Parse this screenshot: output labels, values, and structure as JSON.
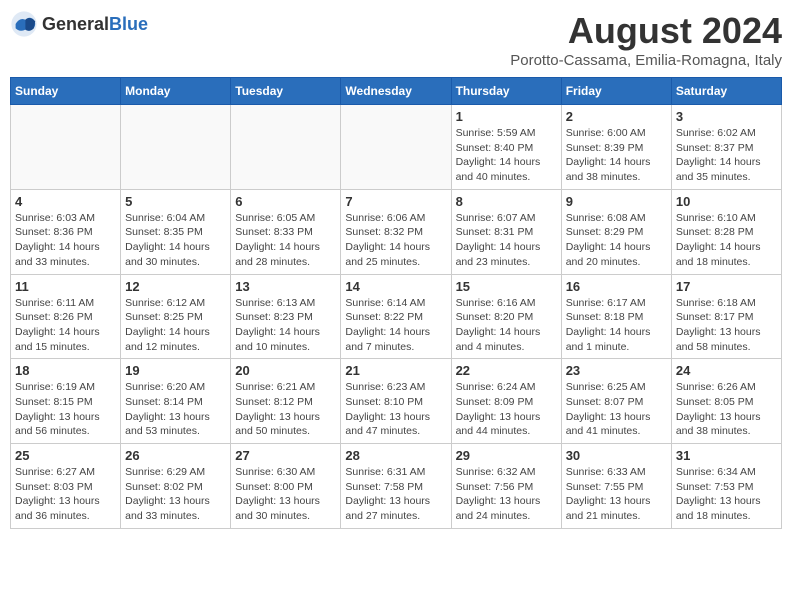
{
  "header": {
    "logo_general": "General",
    "logo_blue": "Blue",
    "main_title": "August 2024",
    "subtitle": "Porotto-Cassama, Emilia-Romagna, Italy"
  },
  "weekdays": [
    "Sunday",
    "Monday",
    "Tuesday",
    "Wednesday",
    "Thursday",
    "Friday",
    "Saturday"
  ],
  "weeks": [
    [
      {
        "day": "",
        "info": ""
      },
      {
        "day": "",
        "info": ""
      },
      {
        "day": "",
        "info": ""
      },
      {
        "day": "",
        "info": ""
      },
      {
        "day": "1",
        "info": "Sunrise: 5:59 AM\nSunset: 8:40 PM\nDaylight: 14 hours\nand 40 minutes."
      },
      {
        "day": "2",
        "info": "Sunrise: 6:00 AM\nSunset: 8:39 PM\nDaylight: 14 hours\nand 38 minutes."
      },
      {
        "day": "3",
        "info": "Sunrise: 6:02 AM\nSunset: 8:37 PM\nDaylight: 14 hours\nand 35 minutes."
      }
    ],
    [
      {
        "day": "4",
        "info": "Sunrise: 6:03 AM\nSunset: 8:36 PM\nDaylight: 14 hours\nand 33 minutes."
      },
      {
        "day": "5",
        "info": "Sunrise: 6:04 AM\nSunset: 8:35 PM\nDaylight: 14 hours\nand 30 minutes."
      },
      {
        "day": "6",
        "info": "Sunrise: 6:05 AM\nSunset: 8:33 PM\nDaylight: 14 hours\nand 28 minutes."
      },
      {
        "day": "7",
        "info": "Sunrise: 6:06 AM\nSunset: 8:32 PM\nDaylight: 14 hours\nand 25 minutes."
      },
      {
        "day": "8",
        "info": "Sunrise: 6:07 AM\nSunset: 8:31 PM\nDaylight: 14 hours\nand 23 minutes."
      },
      {
        "day": "9",
        "info": "Sunrise: 6:08 AM\nSunset: 8:29 PM\nDaylight: 14 hours\nand 20 minutes."
      },
      {
        "day": "10",
        "info": "Sunrise: 6:10 AM\nSunset: 8:28 PM\nDaylight: 14 hours\nand 18 minutes."
      }
    ],
    [
      {
        "day": "11",
        "info": "Sunrise: 6:11 AM\nSunset: 8:26 PM\nDaylight: 14 hours\nand 15 minutes."
      },
      {
        "day": "12",
        "info": "Sunrise: 6:12 AM\nSunset: 8:25 PM\nDaylight: 14 hours\nand 12 minutes."
      },
      {
        "day": "13",
        "info": "Sunrise: 6:13 AM\nSunset: 8:23 PM\nDaylight: 14 hours\nand 10 minutes."
      },
      {
        "day": "14",
        "info": "Sunrise: 6:14 AM\nSunset: 8:22 PM\nDaylight: 14 hours\nand 7 minutes."
      },
      {
        "day": "15",
        "info": "Sunrise: 6:16 AM\nSunset: 8:20 PM\nDaylight: 14 hours\nand 4 minutes."
      },
      {
        "day": "16",
        "info": "Sunrise: 6:17 AM\nSunset: 8:18 PM\nDaylight: 14 hours\nand 1 minute."
      },
      {
        "day": "17",
        "info": "Sunrise: 6:18 AM\nSunset: 8:17 PM\nDaylight: 13 hours\nand 58 minutes."
      }
    ],
    [
      {
        "day": "18",
        "info": "Sunrise: 6:19 AM\nSunset: 8:15 PM\nDaylight: 13 hours\nand 56 minutes."
      },
      {
        "day": "19",
        "info": "Sunrise: 6:20 AM\nSunset: 8:14 PM\nDaylight: 13 hours\nand 53 minutes."
      },
      {
        "day": "20",
        "info": "Sunrise: 6:21 AM\nSunset: 8:12 PM\nDaylight: 13 hours\nand 50 minutes."
      },
      {
        "day": "21",
        "info": "Sunrise: 6:23 AM\nSunset: 8:10 PM\nDaylight: 13 hours\nand 47 minutes."
      },
      {
        "day": "22",
        "info": "Sunrise: 6:24 AM\nSunset: 8:09 PM\nDaylight: 13 hours\nand 44 minutes."
      },
      {
        "day": "23",
        "info": "Sunrise: 6:25 AM\nSunset: 8:07 PM\nDaylight: 13 hours\nand 41 minutes."
      },
      {
        "day": "24",
        "info": "Sunrise: 6:26 AM\nSunset: 8:05 PM\nDaylight: 13 hours\nand 38 minutes."
      }
    ],
    [
      {
        "day": "25",
        "info": "Sunrise: 6:27 AM\nSunset: 8:03 PM\nDaylight: 13 hours\nand 36 minutes."
      },
      {
        "day": "26",
        "info": "Sunrise: 6:29 AM\nSunset: 8:02 PM\nDaylight: 13 hours\nand 33 minutes."
      },
      {
        "day": "27",
        "info": "Sunrise: 6:30 AM\nSunset: 8:00 PM\nDaylight: 13 hours\nand 30 minutes."
      },
      {
        "day": "28",
        "info": "Sunrise: 6:31 AM\nSunset: 7:58 PM\nDaylight: 13 hours\nand 27 minutes."
      },
      {
        "day": "29",
        "info": "Sunrise: 6:32 AM\nSunset: 7:56 PM\nDaylight: 13 hours\nand 24 minutes."
      },
      {
        "day": "30",
        "info": "Sunrise: 6:33 AM\nSunset: 7:55 PM\nDaylight: 13 hours\nand 21 minutes."
      },
      {
        "day": "31",
        "info": "Sunrise: 6:34 AM\nSunset: 7:53 PM\nDaylight: 13 hours\nand 18 minutes."
      }
    ]
  ]
}
